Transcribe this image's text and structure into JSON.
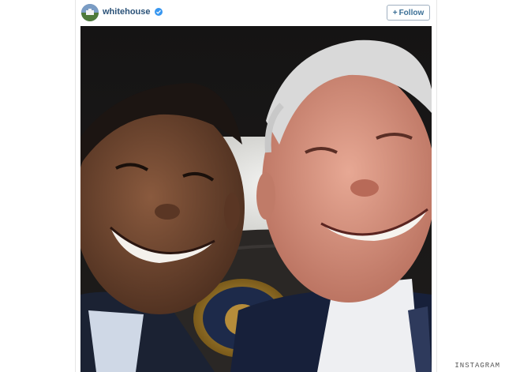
{
  "post": {
    "username": "whitehouse",
    "follow_label": "Follow",
    "follow_plus": "+"
  },
  "source": {
    "watermark": "INSTAGRAM"
  },
  "colors": {
    "username": "#2b5278",
    "verified_badge": "#3897f0",
    "follow_text": "#3b6f96"
  },
  "icons": {
    "verified": "verified-badge-icon",
    "avatar": "whitehouse-avatar"
  }
}
